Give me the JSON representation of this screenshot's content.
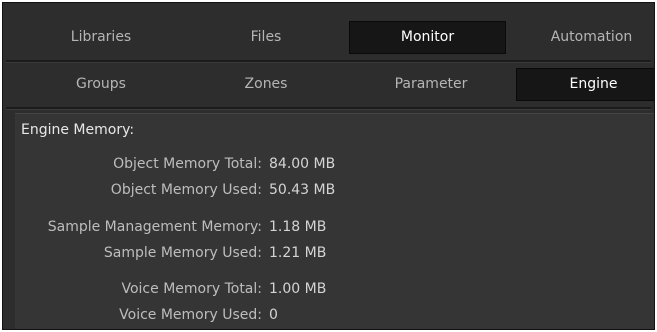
{
  "top_tabs": [
    {
      "label": "Libraries",
      "active": false
    },
    {
      "label": "Files",
      "active": false
    },
    {
      "label": "Monitor",
      "active": true
    },
    {
      "label": "Automation",
      "active": false
    }
  ],
  "sub_tabs": [
    {
      "label": "Groups",
      "active": false
    },
    {
      "label": "Zones",
      "active": false
    },
    {
      "label": "Parameter",
      "active": false
    },
    {
      "label": "Engine",
      "active": true
    }
  ],
  "engine": {
    "title": "Engine Memory:",
    "rows": [
      {
        "label": "Object Memory Total:",
        "value": "84.00 MB"
      },
      {
        "label": "Object Memory Used:",
        "value": "50.43 MB"
      },
      {
        "label": "Sample Management Memory:",
        "value": "1.18 MB"
      },
      {
        "label": "Sample Memory Used:",
        "value": "1.21 MB"
      },
      {
        "label": "Voice Memory Total:",
        "value": "1.00 MB"
      },
      {
        "label": "Voice Memory Used:",
        "value": "0"
      }
    ]
  },
  "colors": {
    "background": "#2d2d2d",
    "active_tab": "#161616",
    "text": "#bdbdbd",
    "active_text": "#ffffff"
  }
}
